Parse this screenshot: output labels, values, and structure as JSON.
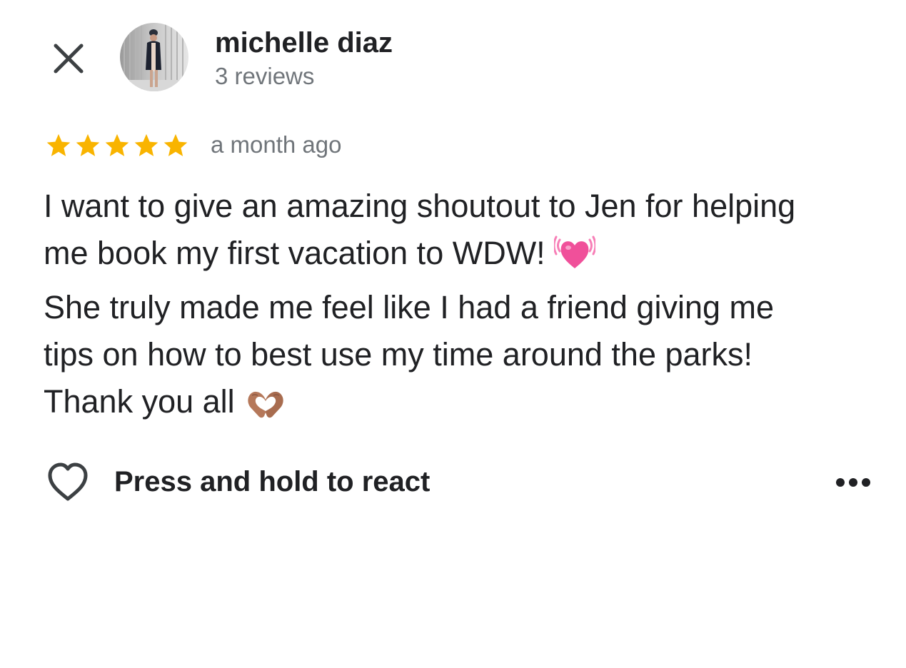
{
  "header": {
    "author_name": "michelle diaz",
    "review_count": "3 reviews",
    "close_icon": "close-icon",
    "avatar_icon": "user-photo"
  },
  "review": {
    "rating": 5,
    "rating_max": 5,
    "time_ago": "a month ago",
    "text_lines": [
      "I want to give an amazing shoutout to Jen for helping",
      "me book my first vacation to WDW!",
      "She truly made me feel like I had a friend giving me",
      "tips on how to best use my time around the parks!",
      "Thank you all"
    ],
    "emoji_1": "beating-heart-emoji",
    "emoji_2": "heart-hands-emoji"
  },
  "actions": {
    "react_label": "Press and hold to react",
    "react_icon": "heart-outline-icon",
    "more_icon": "more-horizontal-icon"
  },
  "colors": {
    "star": "#f9b400",
    "text_primary": "#202124",
    "text_secondary": "#70757a",
    "heart_emoji": "#f0509a",
    "hands_emoji": "#b5785a"
  }
}
